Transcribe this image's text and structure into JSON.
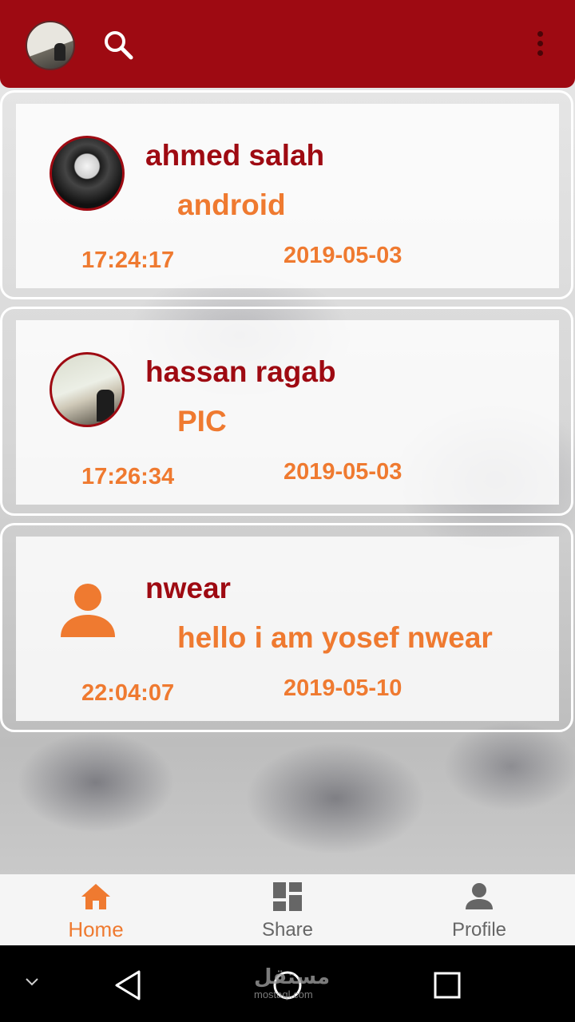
{
  "header": {
    "avatar_icon": "user-avatar",
    "search_icon": "search-icon",
    "menu_icon": "more-vert-icon"
  },
  "posts": [
    {
      "name": "ahmed salah",
      "message": "android",
      "time": "17:24:17",
      "date": "2019-05-03",
      "avatar": "photo"
    },
    {
      "name": "hassan ragab",
      "message": "PIC",
      "time": "17:26:34",
      "date": "2019-05-03",
      "avatar": "photo"
    },
    {
      "name": "nwear",
      "message": "hello i am yosef nwear",
      "time": "22:04:07",
      "date": "2019-05-10",
      "avatar": "person-icon"
    }
  ],
  "bottom_nav": {
    "items": [
      {
        "label": "Home",
        "icon": "home-icon",
        "active": true
      },
      {
        "label": "Share",
        "icon": "dashboard-icon",
        "active": false
      },
      {
        "label": "Profile",
        "icon": "person-icon",
        "active": false
      }
    ]
  },
  "system_bar": {
    "watermark": "مستقل",
    "watermark_sub": "mostaql.com"
  },
  "colors": {
    "primary": "#9e0a12",
    "accent": "#ef7a30"
  }
}
